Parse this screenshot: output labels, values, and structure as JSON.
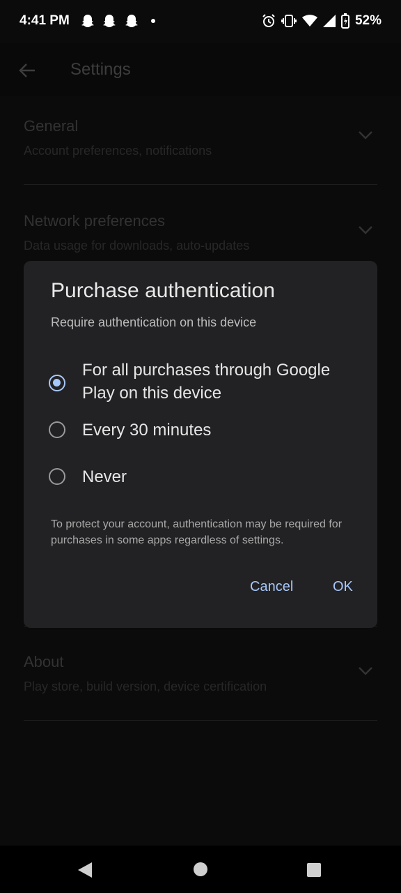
{
  "status_bar": {
    "time": "4:41 PM",
    "battery": "52%",
    "icons": [
      "snapchat-icon",
      "snapchat-icon",
      "snapchat-icon",
      "dot",
      "alarm-icon",
      "vibrate-icon",
      "wifi-icon",
      "signal-icon",
      "battery-icon"
    ]
  },
  "appbar": {
    "title": "Settings"
  },
  "sections": [
    {
      "heading": "General",
      "sub": "Account preferences, notifications"
    },
    {
      "heading": "Network preferences",
      "sub": "Data usage for downloads, auto-updates"
    },
    {
      "heading": "About",
      "sub": "Play store, build version, device certification"
    }
  ],
  "dialog": {
    "title": "Purchase authentication",
    "subtitle": "Require authentication on this device",
    "options": [
      {
        "label": "For all purchases through Google Play on this device",
        "selected": true
      },
      {
        "label": "Every 30 minutes",
        "selected": false
      },
      {
        "label": "Never",
        "selected": false
      }
    ],
    "note": "To protect your account, authentication may be required for purchases in some apps regardless of settings.",
    "cancel": "Cancel",
    "ok": "OK"
  },
  "colors": {
    "accent": "#a8c7fa",
    "background": "#121212",
    "dialog": "#222224"
  }
}
